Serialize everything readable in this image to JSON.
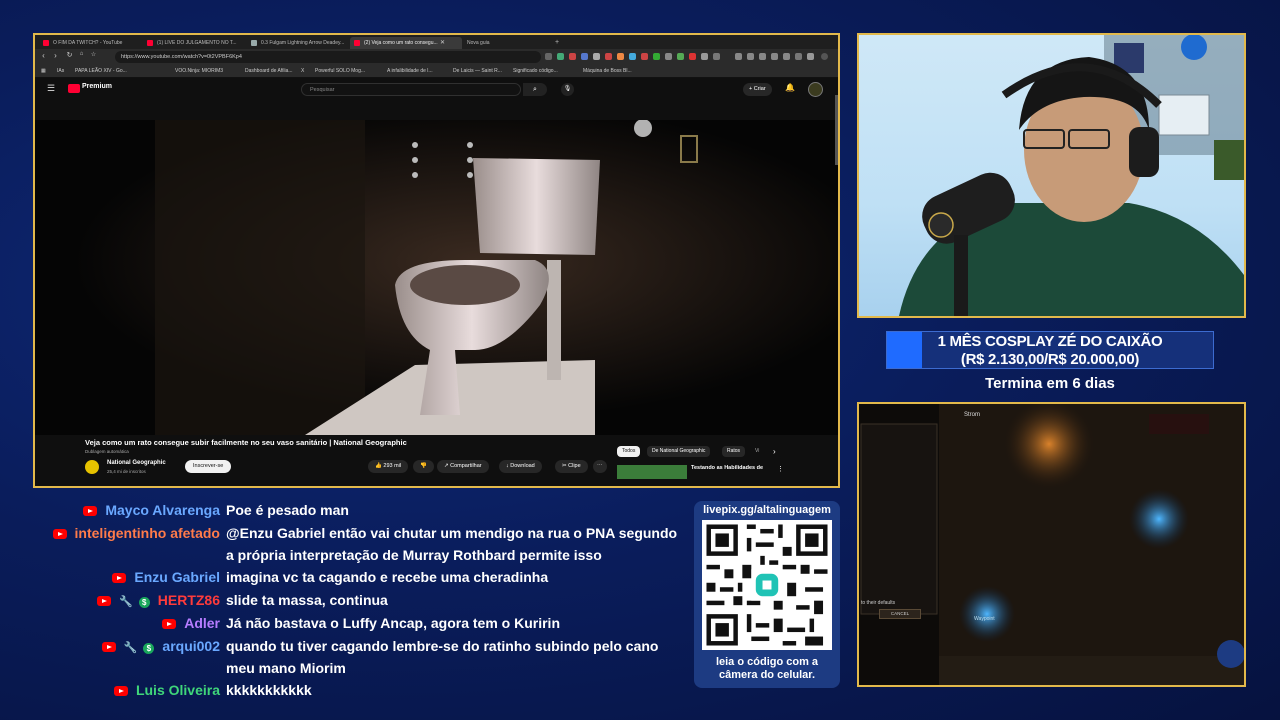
{
  "browser": {
    "tabs": [
      {
        "label": "O FIM DA TWITCH? - YouTube"
      },
      {
        "label": "(1) LIVE DO JULGAMENTO NO T..."
      },
      {
        "label": "0.3 Fulgam Lightning Arrow Deadey..."
      },
      {
        "label": "(2) Veja como um rato consegu..."
      },
      {
        "label": "Nova guia"
      }
    ],
    "url": "https://www.youtube.com/watch?v=0t2VPBF6Kp4",
    "bookmarks": [
      "IAs",
      "PAPA LEÃO XIV - Go...",
      "VOO.Ninja: MIORIM3",
      "Dashboard de Afilia...",
      "X",
      "Powerful SOLO Mog...",
      "A infalibilidade de l...",
      "De Laicis — Saint R...",
      "Significado código...",
      "Máquina de Boss Bl..."
    ]
  },
  "youtube": {
    "brand": "Premium",
    "search_placeholder": "Pesquisar",
    "create_label": "Criar",
    "notif_count": "9+",
    "video_title": "Veja como um rato consegue subir facilmente no seu vaso sanitário | National Geographic",
    "dubbing": "Dublagem automática",
    "channel_name": "National Geographic",
    "channel_subs": "25,4 mi de inscritos",
    "subscribe": "Inscrever-se",
    "likes": "293 mil",
    "share": "Compartilhar",
    "download": "Download",
    "clip": "Clipe",
    "chips": [
      "Todos",
      "De National Geographic",
      "Ratos",
      "Vi"
    ],
    "rec_title": "Testando as Habilidades de"
  },
  "goal": {
    "line1": "1 MÊS COSPLAY ZÉ DO CAIXÃO",
    "line2": "(R$ 2.130,00/R$ 20.000,00)",
    "ends": "Termina em 6 dias",
    "progress": 0.1065,
    "fill_color": "#1f6bff"
  },
  "chat": [
    {
      "name": "Mayco Alvarenga",
      "name_color": "#6aa8ff",
      "badges": [
        "youtube"
      ],
      "text": "Poe é pesado man"
    },
    {
      "name": "inteligentinho afetado",
      "name_color": "#ff7b4a",
      "badges": [
        "youtube"
      ],
      "text": "@Enzu Gabriel então vai chutar um mendigo na rua o PNA segundo a própria interpretação de Murray Rothbard permite isso"
    },
    {
      "name": "Enzu Gabriel",
      "name_color": "#6aa8ff",
      "badges": [
        "youtube"
      ],
      "text": "imagina vc ta cagando e recebe uma cheradinha"
    },
    {
      "name": "HERTZ86",
      "name_color": "#ff3b3b",
      "badges": [
        "youtube",
        "wrench",
        "dollar"
      ],
      "text": "slide ta massa, continua"
    },
    {
      "name": "Adler",
      "name_color": "#b57cff",
      "badges": [
        "youtube"
      ],
      "text": "Já não bastava o Luffy Ancap, agora tem o Kuririn"
    },
    {
      "name": "arqui002",
      "name_color": "#6aa8ff",
      "badges": [
        "youtube",
        "wrench",
        "dollar"
      ],
      "text": "quando tu tiver cagando lembre-se do ratinho subindo pelo cano meu mano Miorim"
    },
    {
      "name": "Luis Oliveira",
      "name_color": "#3fd67a",
      "badges": [
        "youtube"
      ],
      "text": "kkkkkkkkkkk"
    }
  ],
  "qr": {
    "url": "livepix.gg/altalinguagem",
    "caption_line1": "leia o código com a",
    "caption_line2": "câmera do celular."
  },
  "game": {
    "label_top": "Strom",
    "label_waypoint": "Waypoint",
    "label_cancel": "CANCEL",
    "label_defaults": "to their defaults"
  },
  "colors": {
    "frame_border": "#e2b94b",
    "background": "#0a1d5c"
  }
}
